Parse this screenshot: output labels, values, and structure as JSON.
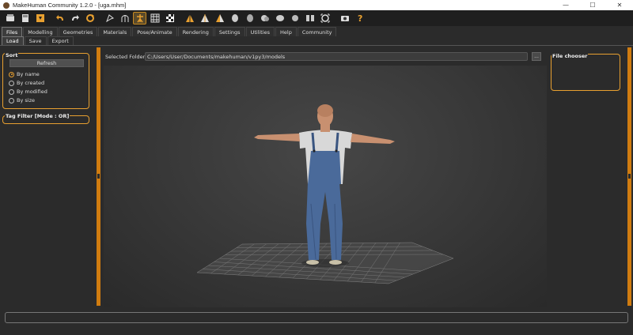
{
  "window": {
    "title": "MakeHuman Community 1.2.0 - [uga.mhm]",
    "minimize": "—",
    "maximize": "☐",
    "close": "✕"
  },
  "toolbar": {
    "icons": [
      "new-file-icon",
      "save-file-icon",
      "export-icon",
      "undo-icon",
      "redo-icon",
      "reset-icon",
      "smooth-icon",
      "wireframe-icon",
      "pose-icon",
      "grid-icon",
      "checker-icon",
      "front-view-icon",
      "back-view-icon",
      "side-view-icon",
      "left-view-icon",
      "right-view-icon",
      "top-view-icon",
      "bottom-view-icon",
      "reset-camera-icon",
      "screenshot-icon",
      "help-icon"
    ],
    "active": "pose-icon"
  },
  "main_tabs": [
    {
      "label": "Files",
      "active": true
    },
    {
      "label": "Modelling",
      "active": false
    },
    {
      "label": "Geometries",
      "active": false
    },
    {
      "label": "Materials",
      "active": false
    },
    {
      "label": "Pose/Animate",
      "active": false
    },
    {
      "label": "Rendering",
      "active": false
    },
    {
      "label": "Settings",
      "active": false
    },
    {
      "label": "Utilities",
      "active": false
    },
    {
      "label": "Help",
      "active": false
    },
    {
      "label": "Community",
      "active": false
    }
  ],
  "sub_tabs": [
    {
      "label": "Load",
      "active": true
    },
    {
      "label": "Save",
      "active": false
    },
    {
      "label": "Export",
      "active": false
    }
  ],
  "sort": {
    "title": "Sort",
    "refresh_label": "Refresh",
    "options": [
      {
        "label": "By name",
        "selected": true
      },
      {
        "label": "By created",
        "selected": false
      },
      {
        "label": "By modified",
        "selected": false
      },
      {
        "label": "By size",
        "selected": false
      }
    ]
  },
  "tag_filter": {
    "title": "Tag Filter [Mode : OR]"
  },
  "folder": {
    "label": "Selected Folder:",
    "path": "C:/Users/User/Documents/makehuman/v1py3/models",
    "browse_label": "..."
  },
  "file_chooser": {
    "title": "File chooser"
  },
  "colors": {
    "accent": "#e8a030",
    "splitter": "#d07c10",
    "background": "#2b2b2b",
    "toolbar": "#1f1f1f"
  }
}
